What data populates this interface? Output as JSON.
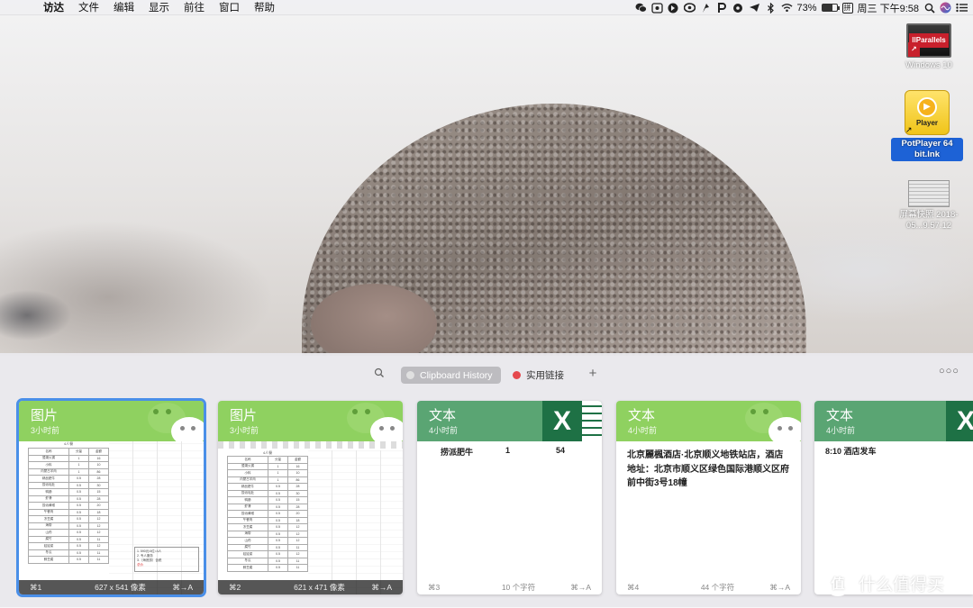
{
  "menubar": {
    "apple": "",
    "items": [
      "访达",
      "文件",
      "编辑",
      "显示",
      "前往",
      "窗口",
      "帮助"
    ],
    "battery_percent": "73%",
    "battery_level": 0.73,
    "clock": "周三 下午9:58",
    "status_icons": [
      "wechat-icon",
      "screenshot-icon",
      "evernote-icon",
      "creative-cloud-icon",
      "shortcut-icon",
      "p-icon",
      "nut-icon",
      "telegram-icon",
      "bluetooth-icon",
      "wifi-icon",
      "battery-icon",
      "input-method-icon",
      "search-icon",
      "siri-icon",
      "notification-icon"
    ],
    "input_method": "拼"
  },
  "desktop": {
    "icons": [
      {
        "label": "Windows 10",
        "badge": "||Parallels"
      },
      {
        "label": "PotPlayer 64 bit.lnk",
        "badge": "Player"
      },
      {
        "label": "屏幕快照 2018-05...9.57.12"
      }
    ]
  },
  "paste": {
    "pinboards": {
      "history": "Clipboard History",
      "links": "实用链接",
      "links_color": "#e5484d"
    },
    "cards": [
      {
        "type": "图片",
        "time": "3小时前",
        "color": "#8fd160",
        "shortcut": "⌘1",
        "meta": "627 x 541 像素",
        "action": "⌘→A",
        "sheet_caption": "4人餐",
        "sheet_headers": [
          "名称",
          "分量",
          "金额"
        ],
        "sheet_rows": [
          [
            "鹭湖火锅",
            "1",
            "16"
          ],
          [
            "小料",
            "1",
            "10"
          ],
          [
            "内蒙古羊肉",
            "1",
            "86"
          ],
          [
            "精品肥牛",
            "0.5",
            "28"
          ],
          [
            "捞派毛肚",
            "0.5",
            "30"
          ],
          [
            "鸭肠",
            "0.5",
            "15"
          ],
          [
            "虾滑",
            "0.5",
            "28"
          ],
          [
            "捞派黄喉",
            "0.5",
            "20"
          ],
          [
            "午餐肉",
            "0.5",
            "18"
          ],
          [
            "冻豆腐",
            "0.5",
            "12"
          ],
          [
            "海带",
            "0.5",
            "12"
          ],
          [
            "山药",
            "0.5",
            "12"
          ],
          [
            "腐竹",
            "0.5",
            "11"
          ],
          [
            "娃娃菜",
            "0.5",
            "12"
          ],
          [
            "冬瓜",
            "0.5",
            "11"
          ],
          [
            "鲜豆腐",
            "0.5",
            "11"
          ]
        ],
        "note": [
          "1. 590元/4位=4人",
          "2. 专人服务",
          "3.（海底捞）含税"
        ],
        "note_red": "总价"
      },
      {
        "type": "图片",
        "time": "3小时前",
        "color": "#8fd160",
        "shortcut": "⌘2",
        "meta": "621 x 471 像素",
        "action": "⌘→A",
        "sheet_caption": "4人餐"
      },
      {
        "type": "文本",
        "time": "4小时前",
        "color": "#5aa573",
        "shortcut": "⌘3",
        "meta": "10 个字符",
        "action": "⌘→A",
        "cells": [
          "捞派肥牛",
          "1",
          "54"
        ]
      },
      {
        "type": "文本",
        "time": "4小时前",
        "color": "#8fd160",
        "shortcut": "⌘4",
        "meta": "44 个字符",
        "action": "⌘→A",
        "text": "北京麗楓酒店·北京顺义地铁站店，酒店地址：北京市顺义区绿色国际港顺义区府前中街3号18幢"
      },
      {
        "type": "文本",
        "time": "4小时前",
        "color": "#5aa573",
        "text": "8:10 酒店发车"
      }
    ]
  },
  "watermark": {
    "logo": "值",
    "text": "什么值得买"
  }
}
